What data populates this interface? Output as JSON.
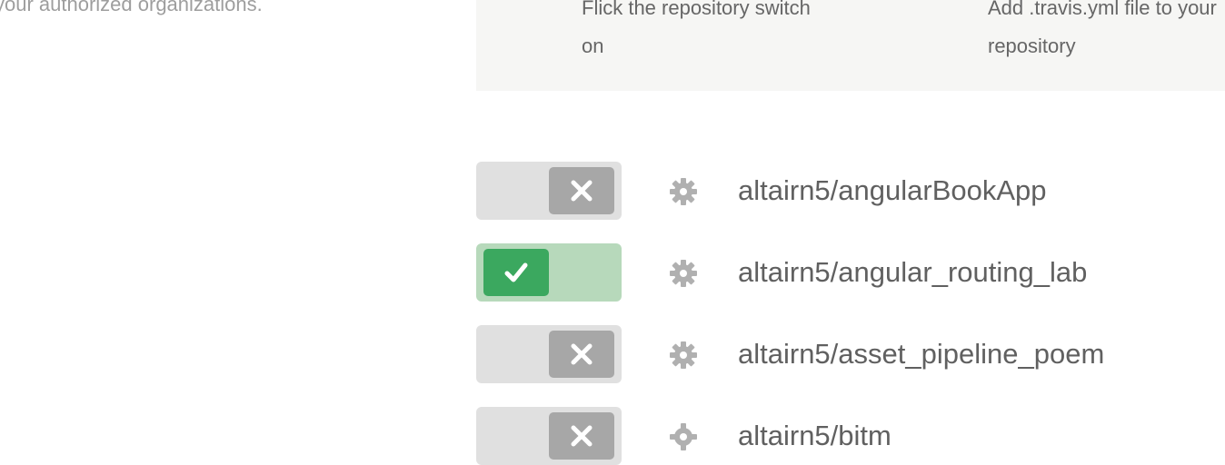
{
  "intro": {
    "partial_text": "your authorized organizations."
  },
  "steps": {
    "step_one": "Flick the repository switch on",
    "step_two": "Add .travis.yml file to your repository"
  },
  "repos": [
    {
      "name": "altairn5/angularBookApp",
      "enabled": false
    },
    {
      "name": "altairn5/angular_routing_lab",
      "enabled": true
    },
    {
      "name": "altairn5/asset_pipeline_poem",
      "enabled": false
    },
    {
      "name": "altairn5/bitm",
      "enabled": false
    }
  ],
  "colors": {
    "toggle_off_track": "#e0e0e0",
    "toggle_off_knob": "#a7a7a7",
    "toggle_on_track": "#b7d9bb",
    "toggle_on_knob": "#3ba85f",
    "gear": "#b0b0b0"
  },
  "icons": {
    "off": "x-icon",
    "on": "check-icon",
    "settings": "gear-icon"
  }
}
